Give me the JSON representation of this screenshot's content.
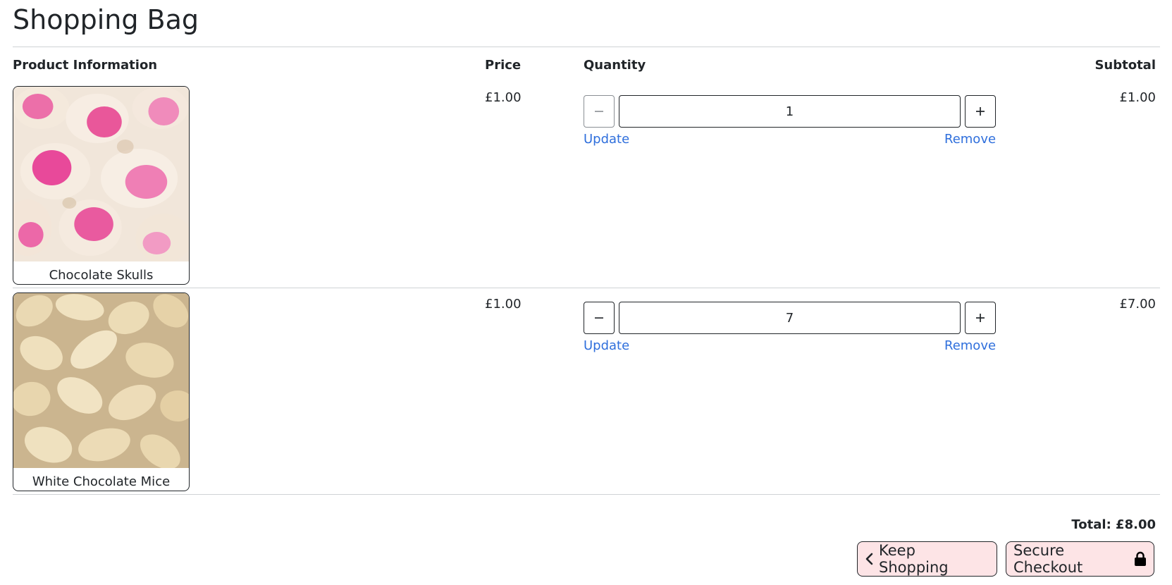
{
  "page_title": "Shopping Bag",
  "table_headers": {
    "product": "Product Information",
    "price": "Price",
    "quantity": "Quantity",
    "subtotal": "Subtotal"
  },
  "items": [
    {
      "name": "Chocolate Skulls",
      "price": "£1.00",
      "quantity": "1",
      "update_label": "Update",
      "remove_label": "Remove",
      "subtotal": "£1.00",
      "image_icon": "pink-white-chocolate-skulls-photo"
    },
    {
      "name": "White Chocolate Mice",
      "price": "£1.00",
      "quantity": "7",
      "update_label": "Update",
      "remove_label": "Remove",
      "subtotal": "£7.00",
      "image_icon": "white-chocolate-mice-photo"
    }
  ],
  "total_label": "Total: £8.00",
  "buttons": {
    "keep_shopping": "Keep Shopping",
    "secure_checkout": "Secure Checkout"
  },
  "colors": {
    "link": "#2f6fdc",
    "button_bg": "#fde4e6",
    "border": "#212529"
  }
}
